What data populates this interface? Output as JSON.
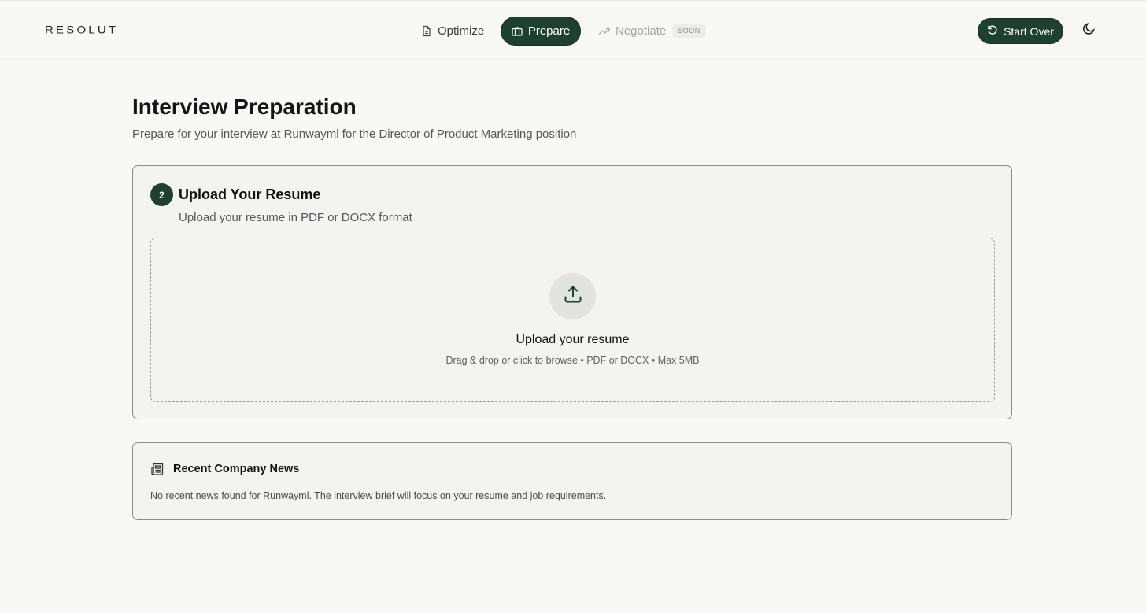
{
  "app": {
    "logo": "RESOLUT"
  },
  "nav": {
    "items": [
      {
        "label": "Optimize",
        "icon": "document-icon",
        "active": false,
        "disabled": false
      },
      {
        "label": "Prepare",
        "icon": "briefcase-icon",
        "active": true,
        "disabled": false
      },
      {
        "label": "Negotiate",
        "icon": "trending-up-icon",
        "active": false,
        "disabled": true
      }
    ],
    "soon_badge": "SOON"
  },
  "header": {
    "start_over_label": "Start Over",
    "start_over_icon": "rotate-ccw-icon",
    "theme_toggle_icon": "moon-icon"
  },
  "page": {
    "title": "Interview Preparation",
    "subtitle": "Prepare for your interview at Runwayml for the Director of Product Marketing position"
  },
  "upload_card": {
    "step_number": "2",
    "title": "Upload Your Resume",
    "subtitle": "Upload your resume in PDF or DOCX format",
    "dropzone": {
      "icon": "upload-icon",
      "title": "Upload your resume",
      "hint": "Drag & drop or click to browse • PDF or DOCX • Max 5MB"
    }
  },
  "news_card": {
    "icon": "newspaper-icon",
    "title": "Recent Company News",
    "text": "No recent news found for Runwayml. The interview brief will focus on your resume and job requirements."
  },
  "colors": {
    "accent": "#1d4030",
    "background": "#f9f8f4",
    "card_background": "#f4f3ef"
  }
}
